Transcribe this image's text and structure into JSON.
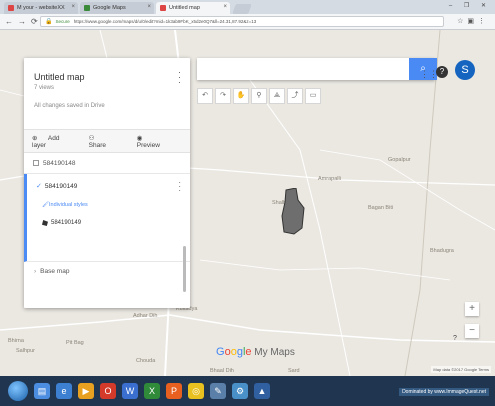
{
  "browser": {
    "tabs": [
      {
        "label": "M your - websiteXX",
        "color": "#d44",
        "active": false
      },
      {
        "label": "Google Maps",
        "color": "#3a8a3a",
        "active": false
      },
      {
        "label": "Untitled map",
        "color": "#d44",
        "active": true
      }
    ],
    "url": "https://www.google.com/maps/d/u/0/edit?mid=1k3ab9FbK_x5d2e0Q7&ll=24.31,87.92&z=13",
    "secure_label": "Secure",
    "window_controls": "– ❐ ✕"
  },
  "panel": {
    "title": "Untitled map",
    "views": "7 views",
    "saved": "All changes saved in Drive",
    "actions": {
      "add_layer": "Add layer",
      "share": "Share",
      "preview": "Preview"
    },
    "layer1": {
      "name": "584190148"
    },
    "layer2": {
      "name": "584190149",
      "styles": "Individual styles",
      "feature": "584190149"
    },
    "basemap": "Base map"
  },
  "search": {
    "placeholder": ""
  },
  "account": {
    "initial": "S",
    "help": "?"
  },
  "map": {
    "places": [
      {
        "name": "Gopalpur"
      },
      {
        "name": "Amrapalli"
      },
      {
        "name": "Shalbari K"
      },
      {
        "name": "Bagan Biti"
      },
      {
        "name": "Bhadugra"
      },
      {
        "name": "Kultadya"
      },
      {
        "name": "Adhar Dih"
      },
      {
        "name": "Bhirna"
      },
      {
        "name": "Pit Bag"
      },
      {
        "name": "Salhpur"
      },
      {
        "name": "Chouda"
      },
      {
        "name": "Bhaal Dih"
      },
      {
        "name": "Sard"
      }
    ],
    "logo": {
      "g": "G",
      "o1": "o",
      "o2": "o",
      "g2": "g",
      "l": "l",
      "e": "e",
      "my_maps": " My Maps"
    },
    "attribution": "Map data ©2017 Google   Terms",
    "zoom_in": "+",
    "zoom_out": "−",
    "help": "?"
  },
  "taskbar": {
    "tray_text": "Dominated by www.ImmageQuest.net"
  }
}
